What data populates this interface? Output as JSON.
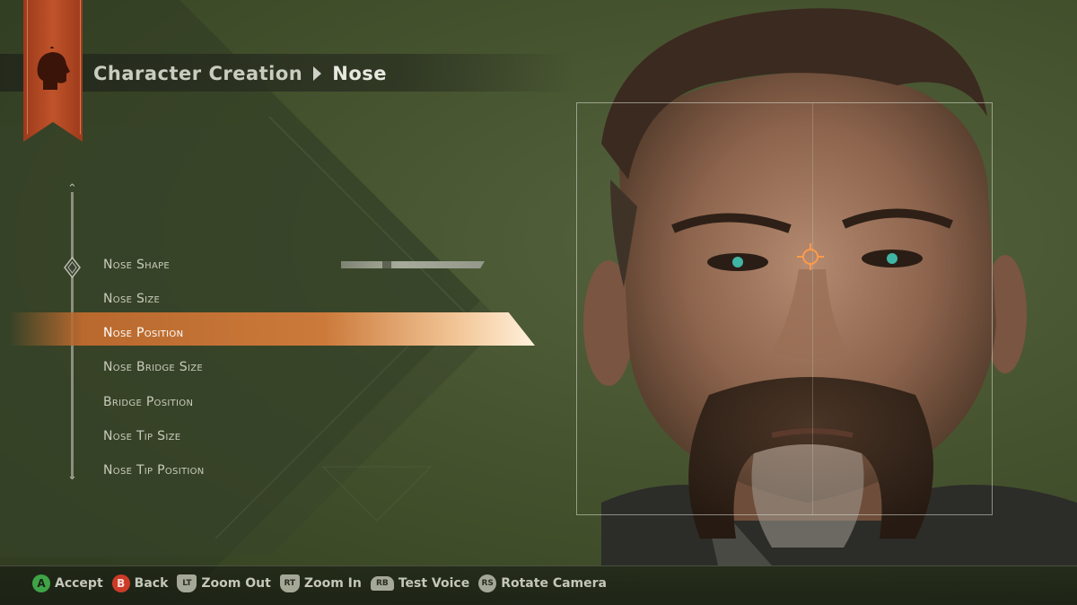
{
  "header": {
    "breadcrumb_parent": "Character Creation",
    "breadcrumb_current": "Nose"
  },
  "menu": {
    "selected_index": 2,
    "items": [
      {
        "label": "Nose Shape"
      },
      {
        "label": "Nose Size"
      },
      {
        "label": "Nose Position"
      },
      {
        "label": "Nose Bridge Size"
      },
      {
        "label": "Bridge Position"
      },
      {
        "label": "Nose Tip Size"
      },
      {
        "label": "Nose Tip Position"
      }
    ]
  },
  "button_prompts": [
    {
      "button": "A",
      "label": "Accept",
      "icon": "a-button-icon"
    },
    {
      "button": "B",
      "label": "Back",
      "icon": "b-button-icon"
    },
    {
      "button": "LT",
      "label": "Zoom Out",
      "icon": "lt-trigger-icon"
    },
    {
      "button": "RT",
      "label": "Zoom In",
      "icon": "rt-trigger-icon"
    },
    {
      "button": "RB",
      "label": "Test Voice",
      "icon": "rb-bumper-icon"
    },
    {
      "button": "RS",
      "label": "Rotate Camera",
      "icon": "rs-stick-icon"
    }
  ],
  "colors": {
    "accent": "#cc7a3b",
    "banner": "#b04a24",
    "background": "#46532f"
  }
}
